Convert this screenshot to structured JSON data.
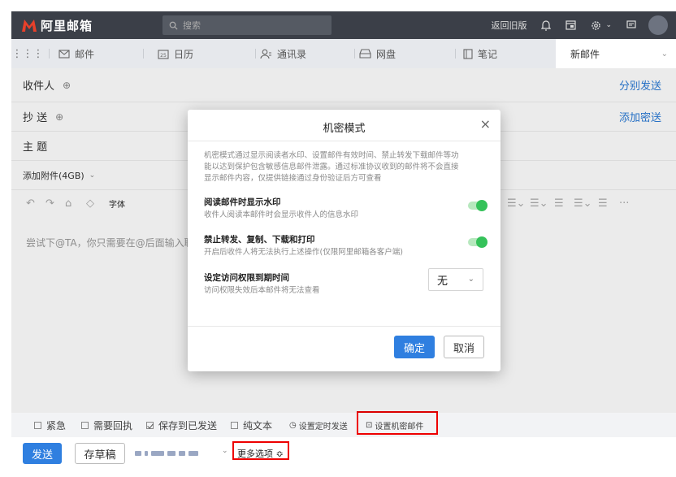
{
  "header": {
    "app_name": "阿里邮箱",
    "search_placeholder": "搜索",
    "old_version": "返回旧版"
  },
  "nav": {
    "tabs": [
      {
        "label": "邮件",
        "icon": "mail-icon"
      },
      {
        "label": "日历",
        "icon": "calendar-icon"
      },
      {
        "label": "通讯录",
        "icon": "contacts-icon"
      },
      {
        "label": "网盘",
        "icon": "drive-icon"
      },
      {
        "label": "笔记",
        "icon": "notes-icon"
      }
    ],
    "active_compose": "新邮件"
  },
  "compose": {
    "to_label": "收件人",
    "cc_label": "抄 送",
    "subject_label": "主 题",
    "send_separately": "分别发送",
    "add_bcc": "添加密送",
    "attach_label": "添加附件(4GB)",
    "font_label": "字体",
    "editor_hint": "尝试下@TA，你只需要在@后面输入联系"
  },
  "options": {
    "urgent": "紧急",
    "need_reply": "需要回执",
    "save_sent": "保存到已发送",
    "plain_text": "纯文本",
    "schedule": "设置定时发送",
    "confidential": "设置机密邮件",
    "send": "发送",
    "draft": "存草稿",
    "more": "更多选项 ≎"
  },
  "modal": {
    "title": "机密模式",
    "description": "机密模式通过显示阅读者水印、设置邮件有效时间、禁止转发下载邮件等功能以达到保护包含敏感信息邮件泄露。通过标准协议收到的邮件将不会直接显示邮件内容，仅提供链接通过身份验证后方可查看",
    "watermark_title": "阅读邮件时显示水印",
    "watermark_sub": "收件人阅读本邮件时会显示收件人的信息水印",
    "watermark_on": true,
    "forbid_title": "禁止转发、复制、下载和打印",
    "forbid_sub": "开启后收件人将无法执行上述操作(仅限阿里邮箱各客户端)",
    "forbid_on": true,
    "expire_title": "设定访问权限到期时间",
    "expire_sub": "访问权限失效后本邮件将无法查看",
    "expire_value": "无",
    "ok": "确定",
    "cancel": "取消"
  },
  "colors": {
    "header_bg": "#3b3f48",
    "primary": "#2f7fe0",
    "toggle_on": "#35c25a",
    "highlight": "#e00000"
  }
}
